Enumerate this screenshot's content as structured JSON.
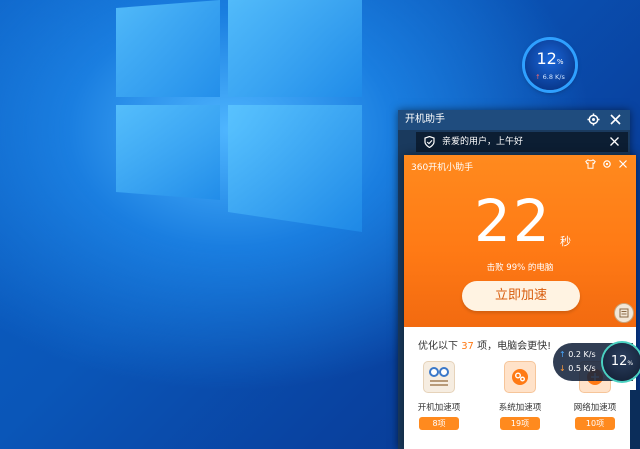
{
  "desktop": {
    "accent": "#0a56b8"
  },
  "speed_ball": {
    "percent": "12",
    "percent_unit": "%",
    "speed": "6.8 K/s",
    "arrow": "↑"
  },
  "startup_helper": {
    "title": "开机助手",
    "greeting": "亲爱的用户，上午好"
  },
  "main_window": {
    "title": "360开机小助手",
    "boot_seconds": "22",
    "seconds_unit": "秒",
    "beat_text": "击败 99% 的电脑",
    "boost_button": "立即加速",
    "optimize_prefix": "优化以下 ",
    "optimize_count": "37",
    "optimize_suffix": " 项，电脑会更快!",
    "categories": [
      {
        "label": "开机加速项",
        "count": "8项"
      },
      {
        "label": "系统加速项",
        "count": "19项"
      },
      {
        "label": "网络加速项",
        "count": "10项"
      }
    ],
    "accent": "#ff7a15"
  },
  "net_widget": {
    "up": "0.2 K/s",
    "down": "0.5 K/s",
    "percent": "12",
    "percent_unit": "%"
  }
}
